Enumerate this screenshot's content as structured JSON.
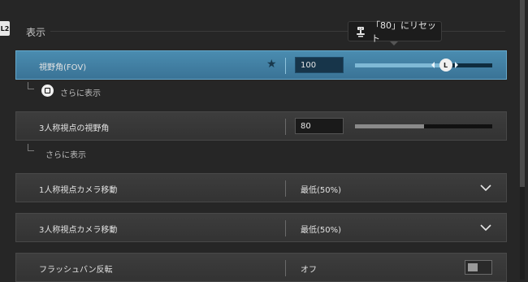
{
  "section": {
    "title": "表示",
    "shortcut_label": "L2"
  },
  "tooltip": {
    "text": "「80」にリセット",
    "button_icon": "l3-stick-icon"
  },
  "rows": [
    {
      "label": "視野角(FOV)",
      "value": "100",
      "slider_level": 0.66,
      "selected": true,
      "favorite": true
    },
    {
      "label": "3人称視点の視野角",
      "value": "80",
      "slider_level": 0.5,
      "selected": false
    },
    {
      "label": "1人称視点カメラ移動",
      "value": "最低(50%)",
      "control": "dropdown"
    },
    {
      "label": "3人称視点カメラ移動",
      "value": "最低(50%)",
      "control": "dropdown"
    },
    {
      "label": "フラッシュバン反転",
      "value": "オフ",
      "control": "toggle",
      "toggle_on": false
    }
  ],
  "more": [
    {
      "label": "さらに表示",
      "button_icon": "square-button-icon"
    },
    {
      "label": "さらに表示"
    }
  ],
  "knob_label": "L",
  "colors": {
    "accent": "#3f7fa3",
    "background": "#262626",
    "row": "#383838"
  }
}
